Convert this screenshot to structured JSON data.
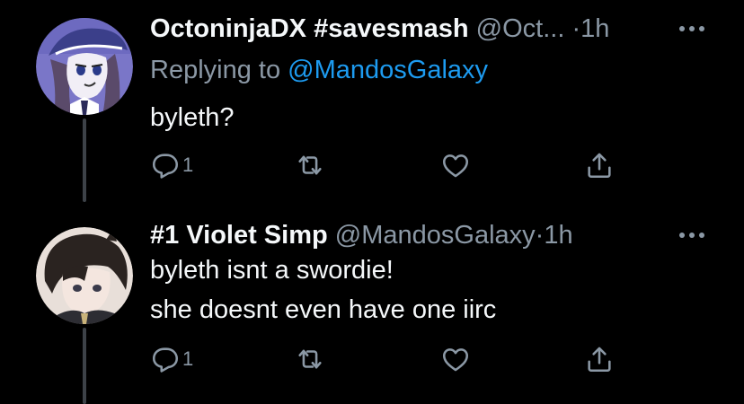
{
  "theme": {
    "background": "#000000",
    "text_primary": "#f5f8fa",
    "text_secondary": "#8b98a5",
    "link": "#1d9bf0",
    "thread_line": "#3d4248"
  },
  "tweets": [
    {
      "display_name": "OctoninjaDX #savesmash",
      "handle": "@Oct...",
      "separator": "·",
      "time": "1h",
      "replying_prefix": "Replying to",
      "replying_to": "@MandosGalaxy",
      "text_lines": [
        "byleth?"
      ],
      "reply_count": "1",
      "avatar_icon": "avatar-octoninja",
      "icons": [
        "reply-icon",
        "retweet-icon",
        "like-icon",
        "share-icon",
        "more-icon"
      ]
    },
    {
      "display_name": "#1 Violet Simp",
      "handle": "@MandosGalaxy",
      "separator": "·",
      "time": "1h",
      "text_lines": [
        "byleth isnt a swordie!",
        "she doesnt even have one iirc"
      ],
      "reply_count": "1",
      "avatar_icon": "avatar-violet-simp",
      "icons": [
        "reply-icon",
        "retweet-icon",
        "like-icon",
        "share-icon",
        "more-icon"
      ]
    }
  ]
}
